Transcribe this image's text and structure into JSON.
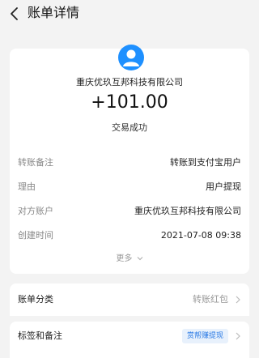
{
  "header": {
    "title": "账单详情"
  },
  "summary": {
    "payee": "重庆优玖互邦科技有限公司",
    "amount": "+101.00",
    "status": "交易成功"
  },
  "details": [
    {
      "label": "转账备注",
      "value": "转账到支付宝用户"
    },
    {
      "label": "理由",
      "value": "用户提现"
    },
    {
      "label": "对方账户",
      "value": "重庆优玖互邦科技有限公司"
    },
    {
      "label": "创建时间",
      "value": "2021-07-08 09:38"
    }
  ],
  "more_label": "更多",
  "category": {
    "label": "账单分类",
    "value": "转账红包"
  },
  "tags": {
    "label": "标签和备注",
    "tag": "赏帮赚提现"
  },
  "colors": {
    "avatar": "#1e90ff",
    "tag_bg": "#e8f1fc",
    "tag_text": "#2c7be5"
  }
}
